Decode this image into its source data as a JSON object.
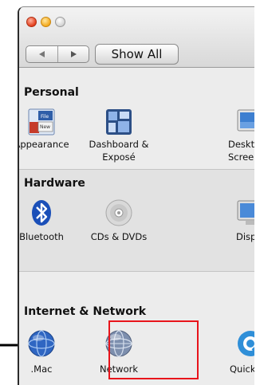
{
  "toolbar": {
    "back_icon": "left-triangle",
    "forward_icon": "right-triangle",
    "show_all_label": "Show All"
  },
  "sections": {
    "personal": {
      "title": "Personal",
      "items": [
        {
          "label": "Appearance",
          "icon": "appearance-icon",
          "icon_text_1": "File",
          "icon_text_2": "New"
        },
        {
          "label_line1": "Dashboard &",
          "label_line2": "Exposé",
          "icon": "dashboard-expose-icon"
        },
        {
          "label_line1": "Deskto",
          "label_line2": "Screen",
          "icon": "desktop-screen-icon"
        }
      ]
    },
    "hardware": {
      "title": "Hardware",
      "items": [
        {
          "label": "Bluetooth",
          "icon": "bluetooth-icon"
        },
        {
          "label": "CDs & DVDs",
          "icon": "cd-dvd-icon"
        },
        {
          "label": "Displ",
          "icon": "display-icon"
        }
      ]
    },
    "internet": {
      "title": "Internet & Network",
      "items": [
        {
          "label": ".Mac",
          "icon": "dotmac-globe-icon"
        },
        {
          "label": "Network",
          "icon": "network-globe-icon"
        },
        {
          "label": "QuickT",
          "icon": "quicktime-icon"
        }
      ]
    }
  },
  "annotation": {
    "highlight_color": "#e8141b",
    "arrow_color": "#000000"
  }
}
